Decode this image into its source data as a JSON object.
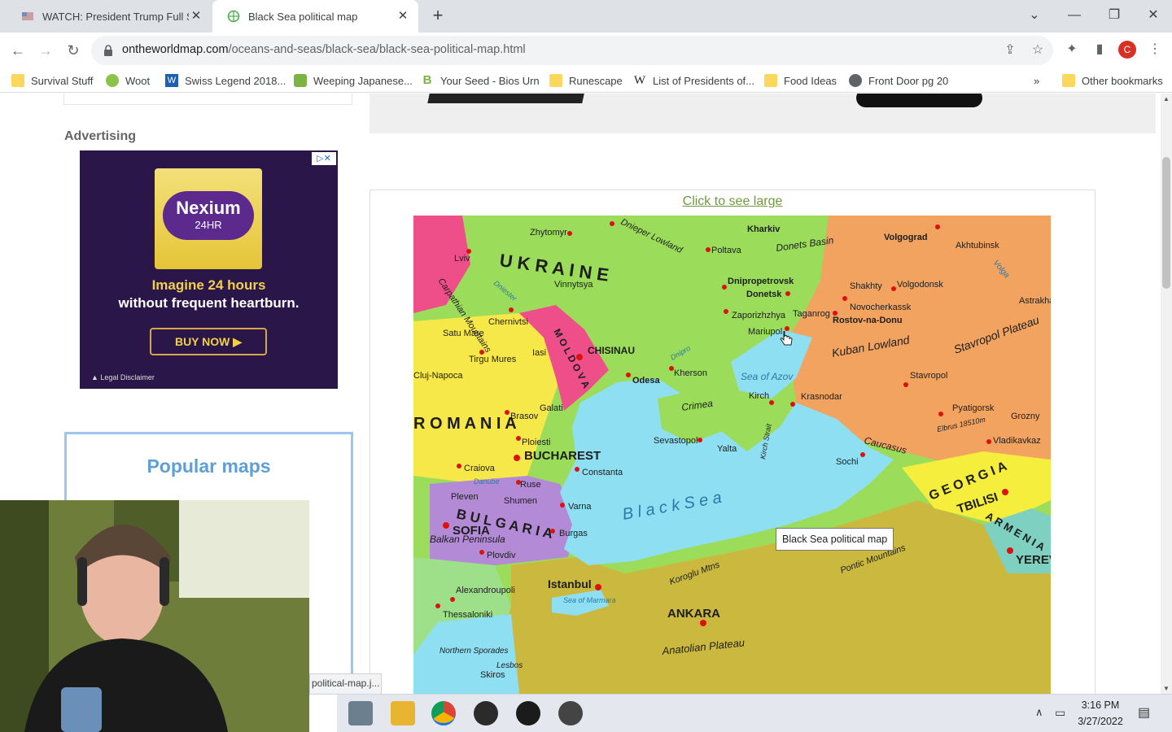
{
  "browser": {
    "tabs": [
      {
        "title": "WATCH: President Trump Full Spé"
      },
      {
        "title": "Black Sea political map"
      }
    ],
    "url_host": "ontheworldmap.com",
    "url_path": "/oceans-and-seas/black-sea/black-sea-political-map.html",
    "profile_initial": "C",
    "bookmarks": [
      {
        "label": "Survival Stuff",
        "icon": "folder-icon"
      },
      {
        "label": "Woot",
        "icon": "woot-icon"
      },
      {
        "label": "Swiss Legend 2018...",
        "icon": "w-icon"
      },
      {
        "label": "Weeping Japanese...",
        "icon": "plant-icon"
      },
      {
        "label": "Your Seed - Bios Urn",
        "icon": "b-icon"
      },
      {
        "label": "Runescape",
        "icon": "folder-icon"
      },
      {
        "label": "List of Presidents of...",
        "icon": "wikipedia-icon"
      },
      {
        "label": "Food Ideas",
        "icon": "folder-icon"
      },
      {
        "label": "Front Door pg 20",
        "icon": "globe-icon"
      }
    ],
    "overflow_label": "»",
    "other_bookmarks": "Other bookmarks"
  },
  "page": {
    "advertising_label": "Advertising",
    "ad": {
      "brand": "Nexium",
      "brand_sub": "24HR",
      "headline": "Imagine 24 hours",
      "subline": "without frequent heartburn.",
      "cta": "BUY NOW",
      "legal": "▲ Legal Disclaimer"
    },
    "popular_title": "Popular maps",
    "map_link": "Click to see large",
    "map_tooltip": "Black Sea political map",
    "status_url": "political-map.j..."
  },
  "map_labels": {
    "countries": [
      "U K R A I N E",
      "R O M A N I A",
      "B U L G A R I A",
      "M O L D O V A",
      "G E O R G I A",
      "A R M E N I A"
    ],
    "sea": "B l a c k   S e a",
    "sea_of_azov": "Sea of Azov",
    "capitals": [
      "BUCHAREST",
      "SOFIA",
      "CHISINAU",
      "ANKARA",
      "TBILISI",
      "YEREV"
    ],
    "cities": [
      "Zhytomyr",
      "Kharkiv",
      "Poltava",
      "Lviv",
      "Vinnytsya",
      "Dnipropetrovsk",
      "Donetsk",
      "Zaporizhzhya",
      "Mariupol",
      "Taganrog",
      "Shakhty",
      "Novocherkassk",
      "Rostov-na-Donu",
      "Volgodonsk",
      "Volgograd",
      "Akhtubinsk",
      "Astrakha",
      "Chernivtsi",
      "Iasi",
      "Satu Mare",
      "Cluj-Napoca",
      "Tirgu Mures",
      "Brasov",
      "Galati",
      "Odesa",
      "Kherson",
      "Kirch",
      "Krasnodar",
      "Stavropol",
      "Pyatigorsk",
      "Grozny",
      "Vladikavkaz",
      "Sochi",
      "Sevastopol",
      "Yalta",
      "Ploiesti",
      "Constanta",
      "Craiova",
      "Ruse",
      "Pleven",
      "Shumen",
      "Varna",
      "Burgas",
      "Plovdiv",
      "Istanbul",
      "Alexandroupoli",
      "Thessaloniki",
      "Skiros"
    ],
    "regions": [
      "Donets Basin",
      "Kuban Lowland",
      "Stavropol Plateau",
      "Crimea",
      "Dnieper Lowland",
      "Carpathian Mountains",
      "Caucasus",
      "Balkan Peninsula",
      "Anatolian Plateau",
      "Pontic Mountains",
      "Koroglu Mtns",
      "Northern Sporades",
      "Lesbos",
      "Sea of Marmara",
      "Kirch Strait",
      "Danube",
      "Dnipro",
      "Dniester",
      "Volga",
      "Elbrus 18510m"
    ]
  },
  "taskbar": {
    "time": "3:16 PM",
    "date": "3/27/2022",
    "apps": [
      "calculator-icon",
      "file-explorer-icon",
      "chrome-icon",
      "obs-icon",
      "roblox-icon",
      "app-icon"
    ]
  }
}
